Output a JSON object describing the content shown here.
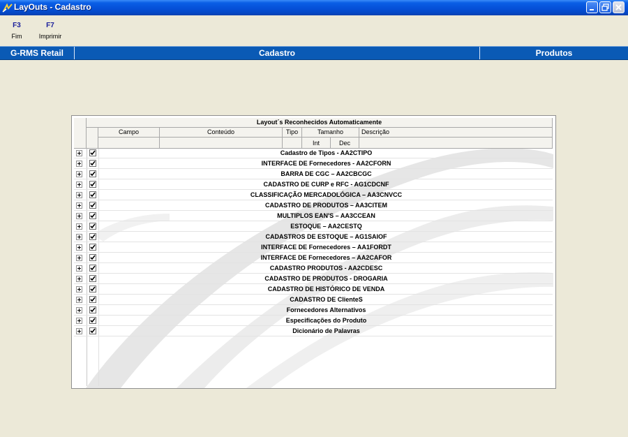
{
  "window": {
    "title": "LayOuts - Cadastro",
    "icons": [
      "app-icon",
      "minimize-icon",
      "maximize-icon",
      "close-icon"
    ]
  },
  "toolbar": {
    "keys": [
      {
        "key": "F3",
        "label": "Fim"
      },
      {
        "key": "F7",
        "label": "Imprimir"
      }
    ]
  },
  "header_strip": {
    "left": "G-RMS Retail",
    "center": "Cadastro",
    "right": "Produtos"
  },
  "grid": {
    "title": "Layout´s Reconhecidos Automaticamente",
    "columns": {
      "campo": "Campo",
      "conteudo": "Conteúdo",
      "tipo": "Tipo",
      "tamanho": "Tamanho",
      "descricao": "Descrição",
      "int": "Int",
      "dec": "Dec"
    },
    "rows": [
      {
        "label": "Cadastro de Tipos - AA2CTIPO",
        "checked": true
      },
      {
        "label": "INTERFACE DE Fornecedores - AA2CFORN",
        "checked": true
      },
      {
        "label": "BARRA DE CGC – AA2CBCGC",
        "checked": true
      },
      {
        "label": "CADASTRO DE CURP e RFC - AG1CDCNF",
        "checked": true
      },
      {
        "label": "CLASSIFICAÇÃO MERCADOLÓGICA – AA3CNVCC",
        "checked": true
      },
      {
        "label": "CADASTRO DE PRODUTOS – AA3CITEM",
        "checked": true
      },
      {
        "label": "MULTIPLOS EAN'S – AA3CCEAN",
        "checked": true
      },
      {
        "label": "ESTOQUE – AA2CESTQ",
        "checked": true
      },
      {
        "label": "CADASTROS DE ESTOQUE – AG1SAIOF",
        "checked": true
      },
      {
        "label": "INTERFACE DE Fornecedores – AA1FORDT",
        "checked": true
      },
      {
        "label": "INTERFACE DE Fornecedores – AA2CAFOR",
        "checked": true
      },
      {
        "label": "CADASTRO PRODUTOS - AA2CDESC",
        "checked": true
      },
      {
        "label": "CADASTRO DE PRODUTOS - DROGARIA",
        "checked": true
      },
      {
        "label": "CADASTRO DE HISTÓRICO DE VENDA",
        "checked": true
      },
      {
        "label": "CADASTRO DE ClienteS",
        "checked": true
      },
      {
        "label": "Fornecedores Alternativos",
        "checked": true
      },
      {
        "label": "Especificações do Produto",
        "checked": true
      },
      {
        "label": "Dicionário de Palavras",
        "checked": true
      }
    ]
  },
  "colors": {
    "titlebar": "#0550d8",
    "header_strip": "#0a5ab5",
    "background": "#ece9d8",
    "fkey_text": "#1a1f9b"
  }
}
